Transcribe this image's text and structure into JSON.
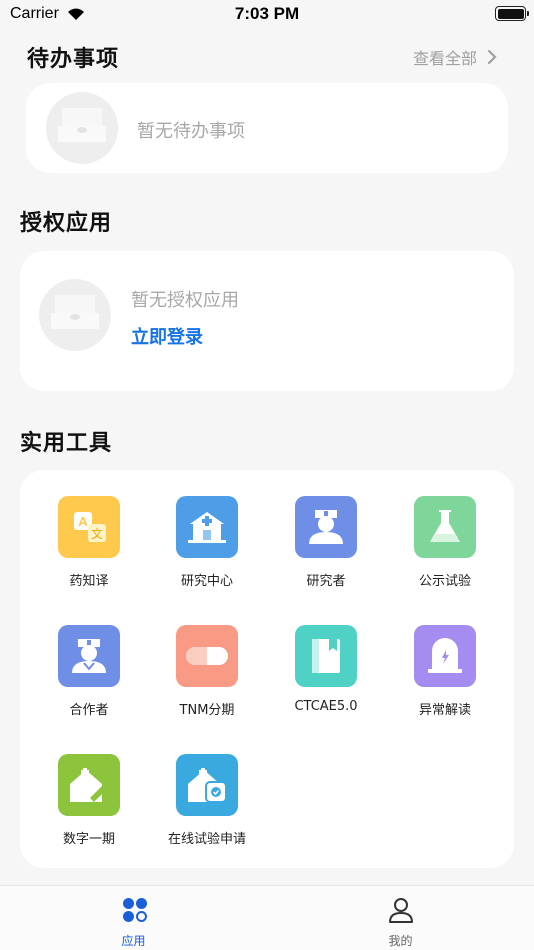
{
  "status_bar": {
    "carrier": "Carrier",
    "time": "7:03 PM"
  },
  "todo": {
    "title": "待办事项",
    "view_all": "查看全部",
    "empty_text": "暂无待办事项"
  },
  "authorized": {
    "title": "授权应用",
    "empty_text": "暂无授权应用",
    "login": "立即登录"
  },
  "tools": {
    "title": "实用工具",
    "items": [
      {
        "label": "药知译",
        "icon": "translate-icon",
        "color": "#ffc94d"
      },
      {
        "label": "研究中心",
        "icon": "hospital-icon",
        "color": "#4d9ee6"
      },
      {
        "label": "研究者",
        "icon": "doctor-icon",
        "color": "#6f8fe6"
      },
      {
        "label": "公示试验",
        "icon": "flask-icon",
        "color": "#7fd69a"
      },
      {
        "label": "合作者",
        "icon": "nurse-icon",
        "color": "#6f8fe6"
      },
      {
        "label": "TNM分期",
        "icon": "pill-icon",
        "color": "#f99b84"
      },
      {
        "label": "CTCAE5.0",
        "icon": "book-icon",
        "color": "#4fd1c5"
      },
      {
        "label": "异常解读",
        "icon": "tombstone-icon",
        "color": "#a48cf0"
      },
      {
        "label": "数字一期",
        "icon": "syringe-icon",
        "color": "#8cc43c"
      },
      {
        "label": "在线试验申请",
        "icon": "application-icon",
        "color": "#3aa9e0"
      }
    ]
  },
  "tabbar": {
    "items": [
      {
        "label": "应用",
        "icon": "apps-icon",
        "active": true,
        "color": "#1a5fd8"
      },
      {
        "label": "我的",
        "icon": "user-icon",
        "active": false,
        "color": "#666666"
      }
    ]
  }
}
